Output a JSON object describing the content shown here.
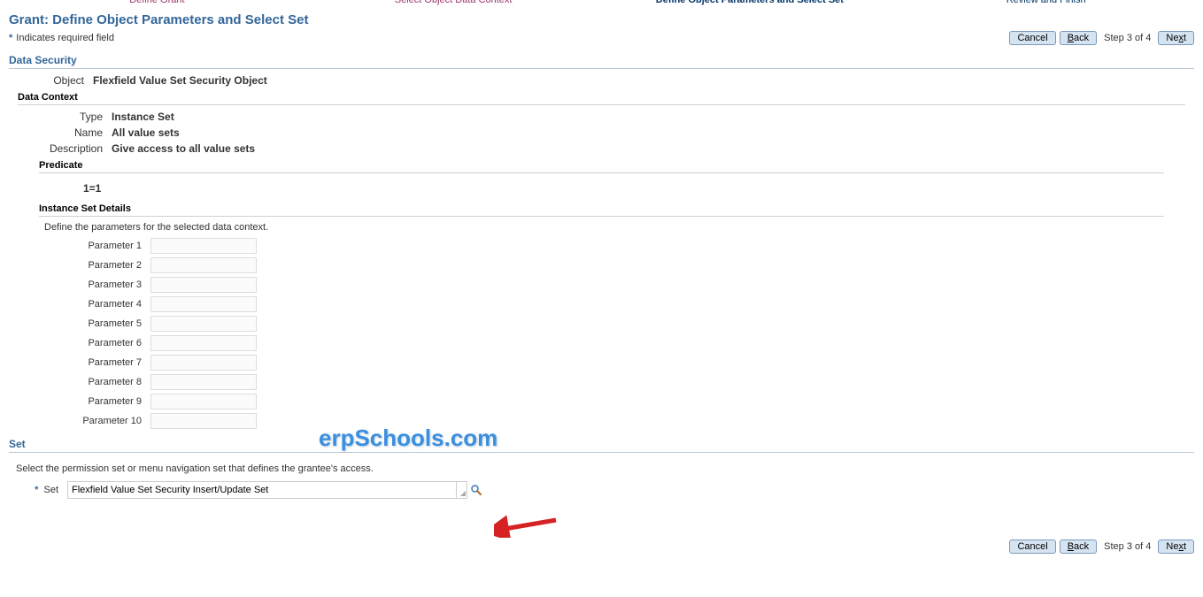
{
  "train": {
    "step1": "Define Grant",
    "step2": "Select Object Data Context",
    "step3": "Define Object Parameters and Select Set",
    "step4": "Review and Finish"
  },
  "page_title": "Grant: Define Object Parameters and Select Set",
  "required_text": "Indicates required field",
  "nav": {
    "cancel": "Cancel",
    "back": "Back",
    "next": "Next",
    "step_text": "Step 3 of 4",
    "back_u": "B",
    "back_rest": "ack",
    "next_rest": "Ne",
    "next_u": "x",
    "next_end": "t"
  },
  "data_security": {
    "heading": "Data Security",
    "object_label": "Object",
    "object_value": "Flexfield Value Set Security Object",
    "context": {
      "heading": "Data Context",
      "type_label": "Type",
      "type_value": "Instance Set",
      "name_label": "Name",
      "name_value": "All value sets",
      "desc_label": "Description",
      "desc_value": "Give access to all value sets"
    },
    "predicate": {
      "heading": "Predicate",
      "value": "1=1"
    },
    "instance_details": {
      "heading": "Instance Set Details",
      "instruction": "Define the parameters for the selected data context.",
      "p1": "Parameter 1",
      "p2": "Parameter 2",
      "p3": "Parameter 3",
      "p4": "Parameter 4",
      "p5": "Parameter 5",
      "p6": "Parameter 6",
      "p7": "Parameter 7",
      "p8": "Parameter 8",
      "p9": "Parameter 9",
      "p10": "Parameter 10"
    }
  },
  "set": {
    "heading": "Set",
    "instruction": "Select the permission set or menu navigation set that defines the grantee's access.",
    "label": "Set",
    "value": "Flexfield Value Set Security Insert/Update Set"
  },
  "watermark": "erpSchools.com"
}
